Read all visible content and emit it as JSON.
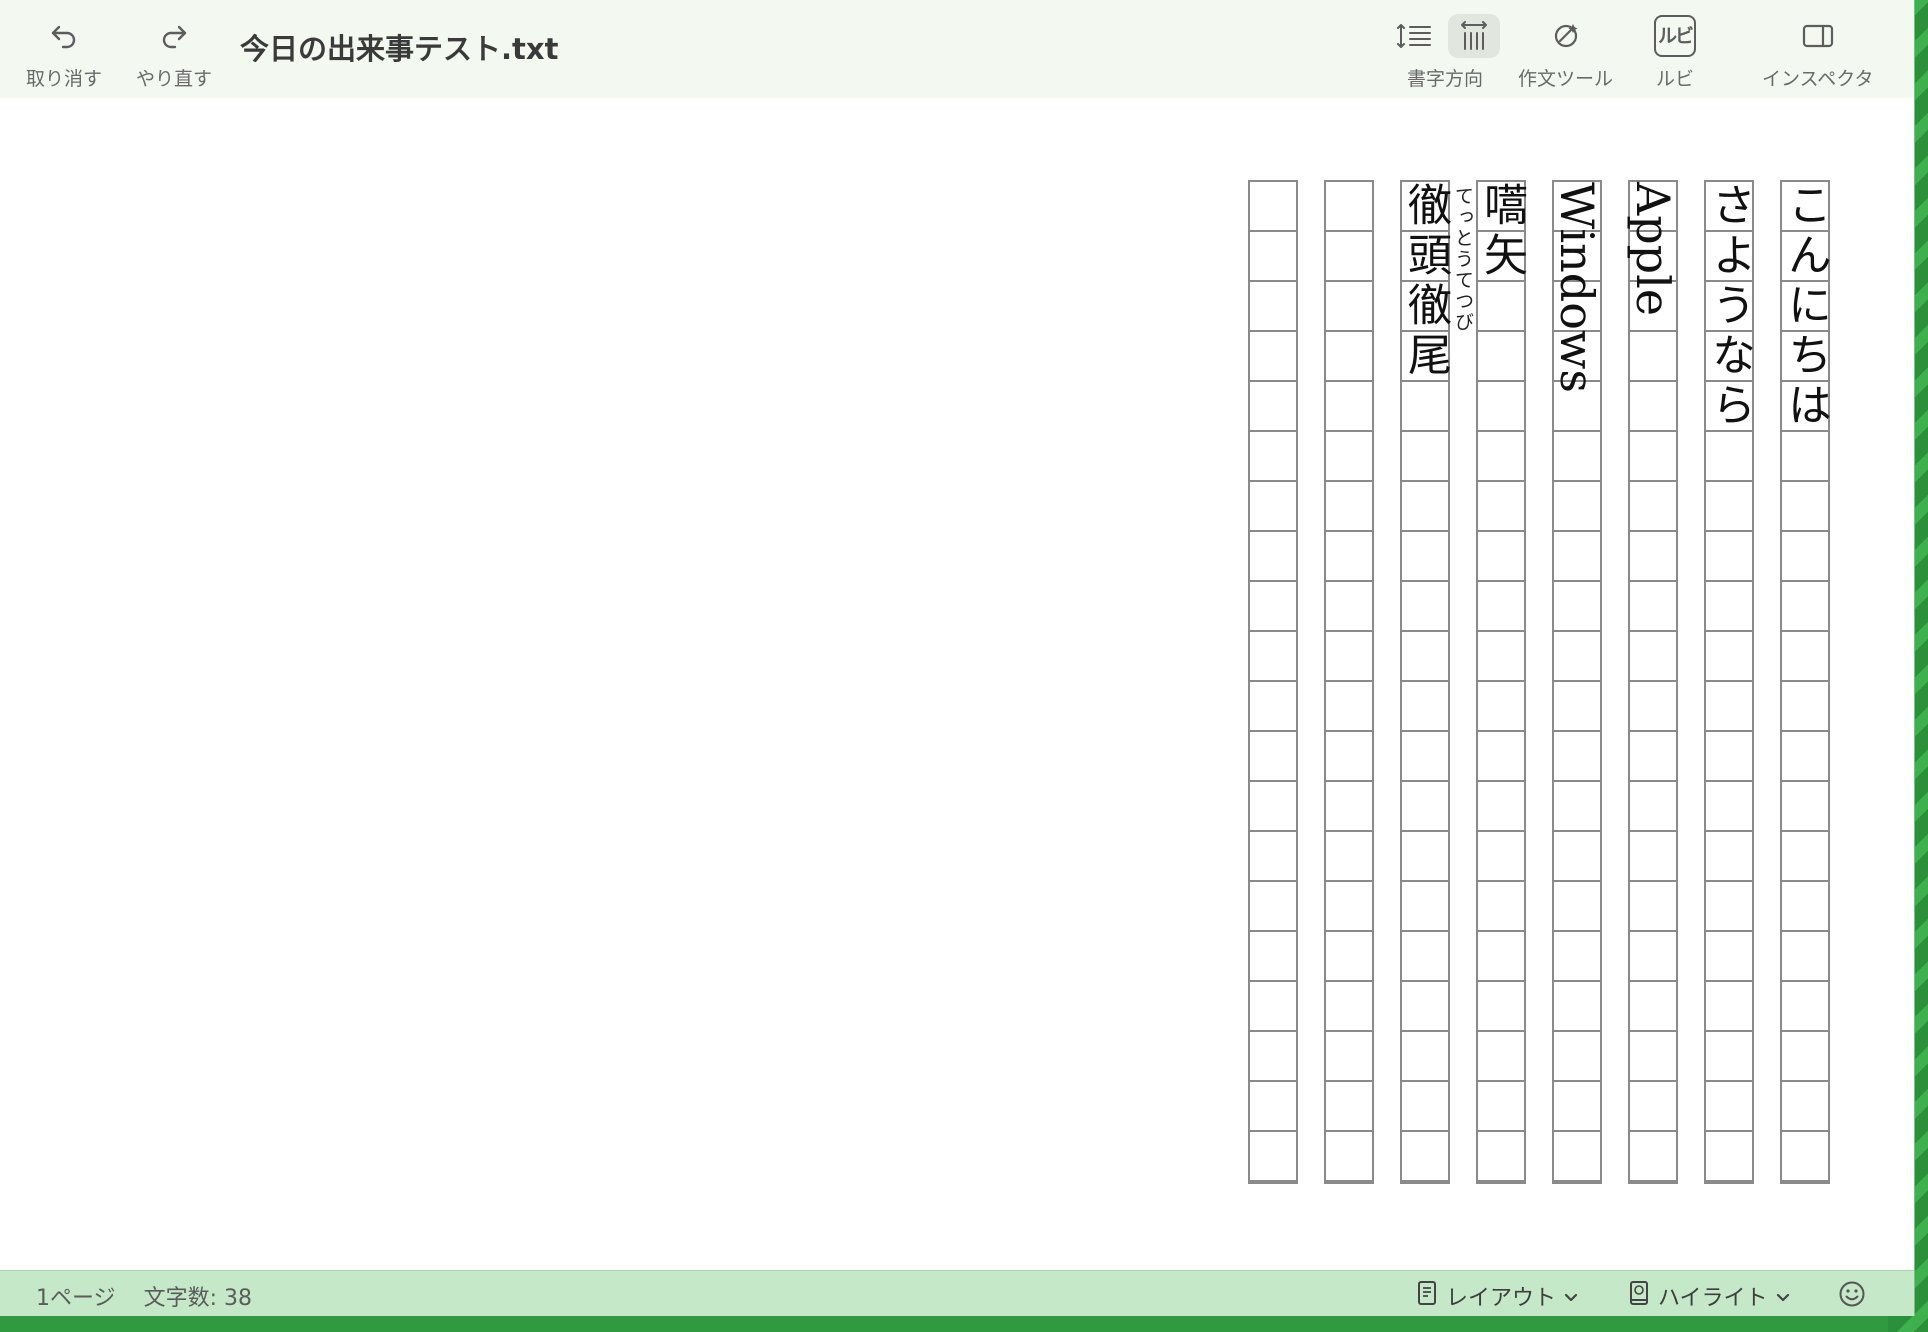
{
  "toolbar": {
    "undo_label": "取り消す",
    "redo_label": "やり直す",
    "title": "今日の出来事テスト.txt",
    "direction_label": "書字方向",
    "writing_tools_label": "作文ツール",
    "ruby_label": "ルビ",
    "ruby_icon_text": "ルビ",
    "inspector_label": "インスペクタ"
  },
  "document": {
    "columns": [
      {
        "text": "こんにちは"
      },
      {
        "text": "さようなら"
      },
      {
        "text": "Apple"
      },
      {
        "text": "Windows"
      },
      {
        "text": "嚆矢"
      },
      {
        "text": "徹頭徹尾",
        "ruby": "てっとうてつび"
      },
      {
        "text": ""
      },
      {
        "text": ""
      }
    ]
  },
  "statusbar": {
    "page_count": "1ページ",
    "char_count": "文字数: 38",
    "layout_label": "レイアウト",
    "highlight_label": "ハイライト"
  },
  "colors": {
    "toolbar_bg": "#f3f8f1",
    "statusbar_bg": "#c5e8c8",
    "grid_line": "#8a8a8a",
    "desktop": "#2f9a3f"
  }
}
